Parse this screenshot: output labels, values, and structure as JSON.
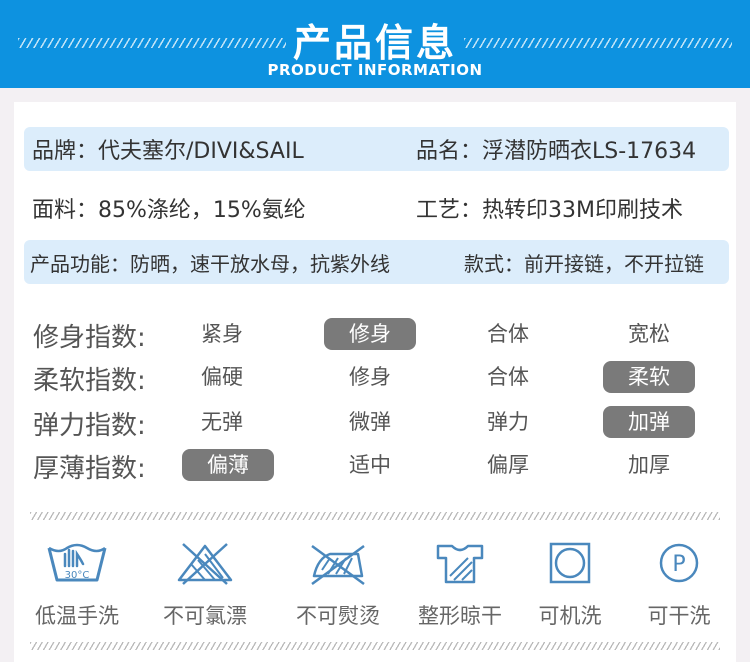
{
  "header": {
    "title": "产品信息",
    "subtitle": "PRODUCT INFORMATION"
  },
  "info": {
    "brand": "品牌：代夫塞尔/DIVI&SAIL",
    "name": "品名：浮潜防晒衣LS-17634",
    "fabric": "面料：85%涤纶，15%氨纶",
    "craft": "工艺：热转印33M印刷技术",
    "function": "产品功能：防晒，速干放水母，抗紫外线",
    "style": "款式：前开接链，不开拉链"
  },
  "indices": [
    {
      "label": "修身指数:",
      "options": [
        "紧身",
        "修身",
        "合体",
        "宽松"
      ],
      "selected": 1
    },
    {
      "label": "柔软指数:",
      "options": [
        "偏硬",
        "修身",
        "合体",
        "柔软"
      ],
      "selected": 3
    },
    {
      "label": "弹力指数:",
      "options": [
        "无弹",
        "微弹",
        "弹力",
        "加弹"
      ],
      "selected": 3
    },
    {
      "label": "厚薄指数:",
      "options": [
        "偏薄",
        "适中",
        "偏厚",
        "加厚"
      ],
      "selected": 0
    }
  ],
  "care": [
    {
      "icon": "hand-wash-icon",
      "label": "低温手洗",
      "temp": "30°C"
    },
    {
      "icon": "no-bleach-icon",
      "label": "不可氯漂"
    },
    {
      "icon": "no-iron-icon",
      "label": "不可熨烫"
    },
    {
      "icon": "line-dry-icon",
      "label": "整形晾干"
    },
    {
      "icon": "machine-wash-icon",
      "label": "可机洗"
    },
    {
      "icon": "dry-clean-icon",
      "label": "可干洗",
      "mark": "P"
    }
  ],
  "colors": {
    "header": "#0d92e0",
    "band": "#dcedfb",
    "selected": "#7a7a7a",
    "icon": "#4a88bd"
  }
}
